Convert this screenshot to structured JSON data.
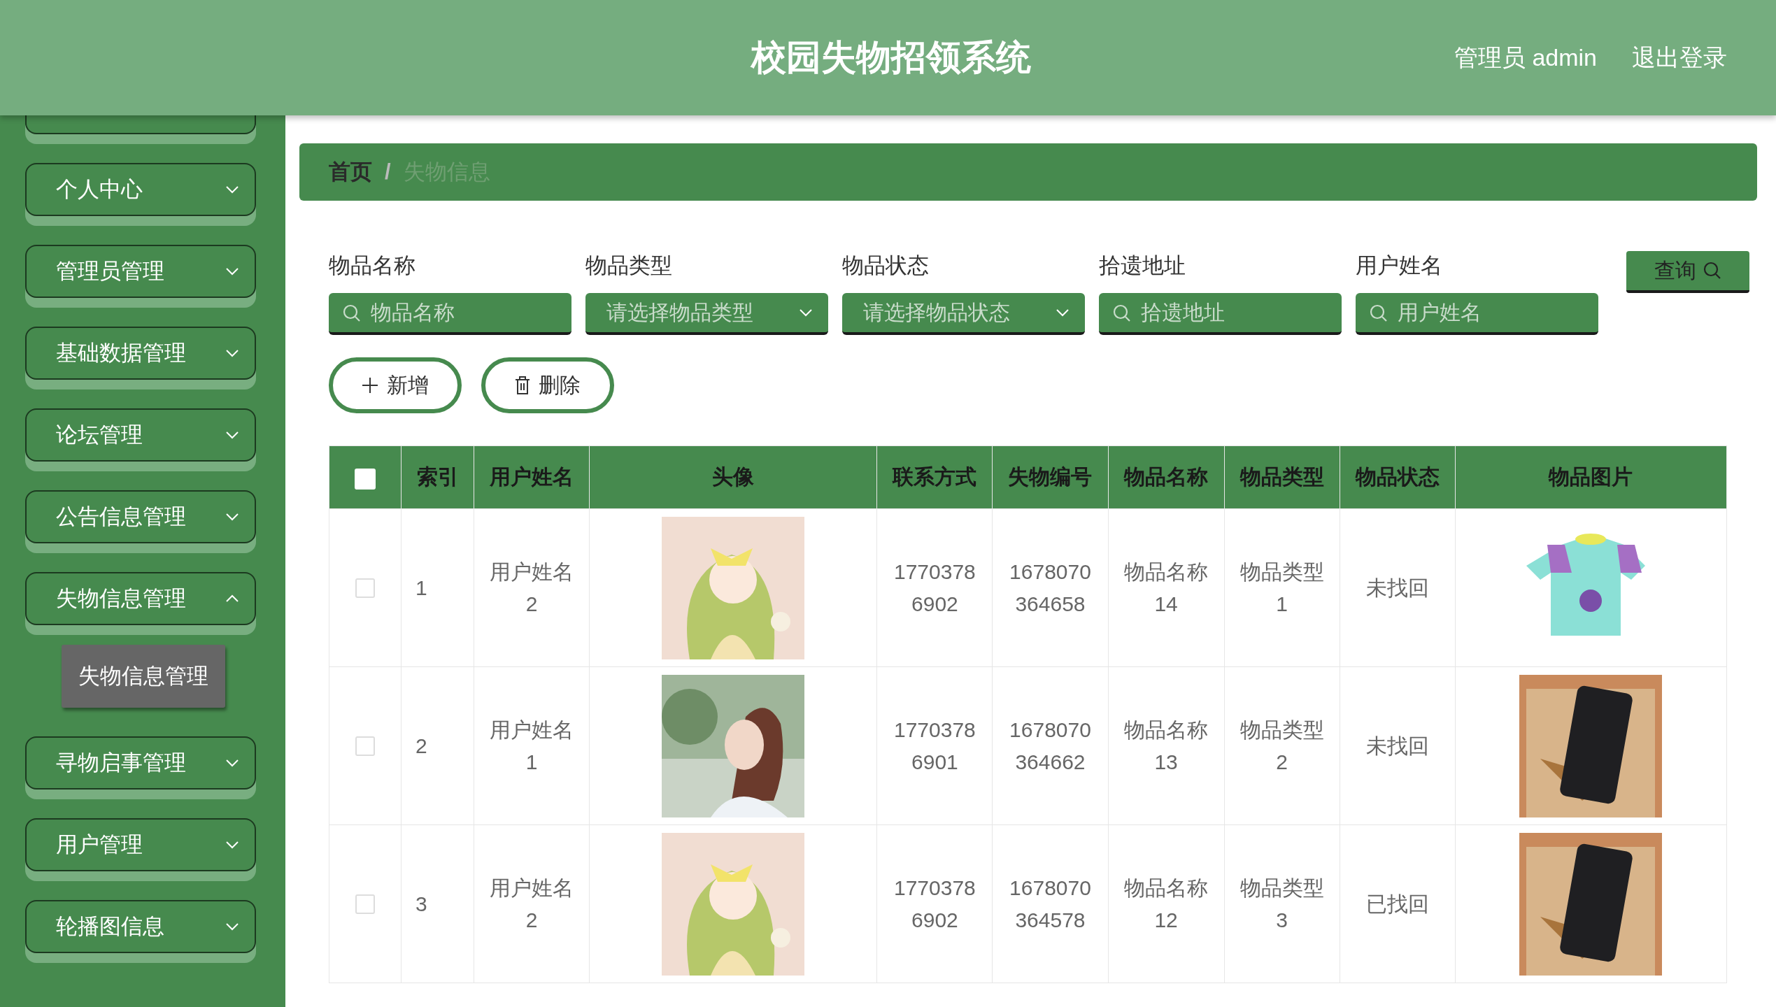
{
  "header": {
    "title": "校园失物招领系统",
    "user_label": "管理员 admin",
    "logout": "退出登录"
  },
  "sidebar": {
    "items": [
      {
        "kind": "partial"
      },
      {
        "kind": "menu",
        "label": "个人中心",
        "expanded": false
      },
      {
        "kind": "menu",
        "label": "管理员管理",
        "expanded": false
      },
      {
        "kind": "menu",
        "label": "基础数据管理",
        "expanded": false
      },
      {
        "kind": "menu",
        "label": "论坛管理",
        "expanded": false
      },
      {
        "kind": "menu",
        "label": "公告信息管理",
        "expanded": false
      },
      {
        "kind": "menu",
        "label": "失物信息管理",
        "expanded": true,
        "children": [
          {
            "label": "失物信息管理",
            "selected": true
          }
        ]
      },
      {
        "kind": "menu",
        "label": "寻物启事管理",
        "expanded": false
      },
      {
        "kind": "menu",
        "label": "用户管理",
        "expanded": false
      },
      {
        "kind": "menu",
        "label": "轮播图信息",
        "expanded": false
      }
    ]
  },
  "breadcrumb": [
    {
      "label": "首页",
      "current": false
    },
    {
      "label": "失物信息",
      "current": true
    }
  ],
  "breadcrumb_separator": "/",
  "filters": [
    {
      "label": "物品名称",
      "kind": "search",
      "placeholder": "物品名称"
    },
    {
      "label": "物品类型",
      "kind": "select",
      "placeholder": "请选择物品类型"
    },
    {
      "label": "物品状态",
      "kind": "select",
      "placeholder": "请选择物品状态"
    },
    {
      "label": "拾遗地址",
      "kind": "search",
      "placeholder": "拾遗地址"
    },
    {
      "label": "用户姓名",
      "kind": "search",
      "placeholder": "用户姓名"
    }
  ],
  "query_button": "查询",
  "actions": [
    {
      "kind": "add",
      "label": "新增"
    },
    {
      "kind": "delete",
      "label": "删除"
    }
  ],
  "table": {
    "header_checked": false,
    "columns": [
      "索引",
      "用户姓名",
      "头像",
      "联系方式",
      "失物编号",
      "物品名称",
      "物品类型",
      "物品状态",
      "物品图片"
    ],
    "rows": [
      {
        "checked": false,
        "index": "1",
        "user_name": "用户姓名2",
        "contact": "17703786902",
        "lost_id": "1678070364658",
        "item_name": "物品名称14",
        "item_type": "物品类型1",
        "status": "未找回"
      },
      {
        "checked": false,
        "index": "2",
        "user_name": "用户姓名1",
        "contact": "17703786901",
        "lost_id": "1678070364662",
        "item_name": "物品名称13",
        "item_type": "物品类型2",
        "status": "未找回"
      },
      {
        "checked": false,
        "index": "3",
        "user_name": "用户姓名2",
        "contact": "17703786902",
        "lost_id": "1678070364578",
        "item_name": "物品名称12",
        "item_type": "物品类型3",
        "status": "已找回"
      }
    ]
  }
}
